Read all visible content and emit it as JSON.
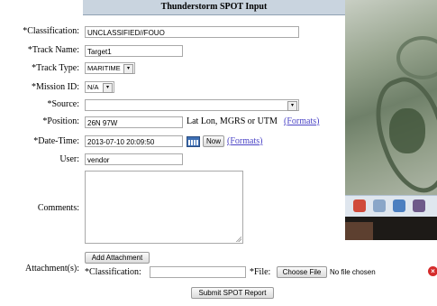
{
  "form": {
    "title": "Thunderstorm SPOT Input",
    "labels": {
      "classification": "*Classification:",
      "track_name": "*Track Name:",
      "track_type": "*Track Type:",
      "mission_id": "*Mission ID:",
      "source": "*Source:",
      "position": "*Position:",
      "date_time": "*Date-Time:",
      "user": "User:",
      "comments": "Comments:",
      "attachments": "Attachment(s):",
      "attach_classification": "*Classification:",
      "file": "*File:"
    },
    "values": {
      "classification": "UNCLASSIFIED//FOUO",
      "track_name": "Target1",
      "track_type": "MARITIME",
      "mission_id": "N/A",
      "source": "",
      "position": "26N 97W",
      "date_time": "2013-07-10 20:09:50",
      "user": "vendor",
      "comments": "",
      "attach_classification": ""
    },
    "position_hint": "Lat Lon, MGRS or UTM",
    "formats_link": "(Formats)",
    "now_button": "Now",
    "add_attachment_button": "Add Attachment",
    "choose_file_button": "Choose File",
    "no_file_text": "No file chosen",
    "submit_button": "Submit SPOT Report"
  }
}
